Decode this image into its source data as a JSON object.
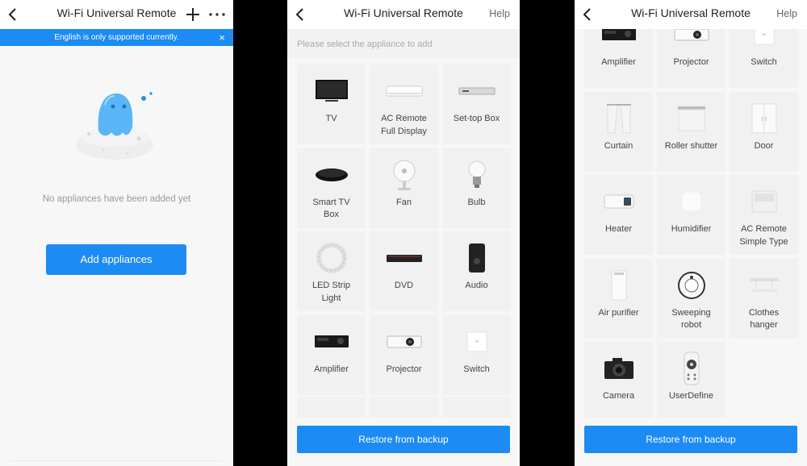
{
  "screen1": {
    "title": "Wi-Fi Universal Remote",
    "banner_text": "English is only supported currently.",
    "banner_close": "×",
    "empty_text": "No appliances have been added yet",
    "add_button": "Add appliances"
  },
  "screen2": {
    "title": "Wi-Fi Universal Remote",
    "help": "Help",
    "subhead": "Please select the appliance to add",
    "tiles": [
      {
        "label": "TV",
        "icon": "tv-icon"
      },
      {
        "label": "AC Remote\nFull Display",
        "icon": "ac-icon"
      },
      {
        "label": "Set-top Box",
        "icon": "settop-box-icon"
      },
      {
        "label": "Smart TV\nBox",
        "icon": "smart-tv-box-icon"
      },
      {
        "label": "Fan",
        "icon": "fan-icon"
      },
      {
        "label": "Bulb",
        "icon": "bulb-icon"
      },
      {
        "label": "LED Strip\nLight",
        "icon": "led-strip-icon"
      },
      {
        "label": "DVD",
        "icon": "dvd-icon"
      },
      {
        "label": "Audio",
        "icon": "audio-icon"
      },
      {
        "label": "Amplifier",
        "icon": "amplifier-icon"
      },
      {
        "label": "Projector",
        "icon": "projector-icon"
      },
      {
        "label": "Switch",
        "icon": "switch-icon"
      }
    ],
    "restore": "Restore from backup"
  },
  "screen3": {
    "title": "Wi-Fi Universal Remote",
    "help": "Help",
    "tiles": [
      {
        "label": "Amplifier",
        "icon": "amplifier-icon"
      },
      {
        "label": "Projector",
        "icon": "projector-icon"
      },
      {
        "label": "Switch",
        "icon": "switch-icon"
      },
      {
        "label": "Curtain",
        "icon": "curtain-icon"
      },
      {
        "label": "Roller shutter",
        "icon": "roller-shutter-icon"
      },
      {
        "label": "Door",
        "icon": "door-icon"
      },
      {
        "label": "Heater",
        "icon": "heater-icon"
      },
      {
        "label": "Humidifier",
        "icon": "humidifier-icon"
      },
      {
        "label": "AC Remote\nSimple Type",
        "icon": "ac-simple-icon"
      },
      {
        "label": "Air purifier",
        "icon": "air-purifier-icon"
      },
      {
        "label": "Sweeping\nrobot",
        "icon": "sweeping-robot-icon"
      },
      {
        "label": "Clothes\nhanger",
        "icon": "clothes-hanger-icon"
      },
      {
        "label": "Camera",
        "icon": "camera-icon"
      },
      {
        "label": "UserDefine",
        "icon": "user-define-icon"
      }
    ],
    "restore": "Restore from backup"
  },
  "colors": {
    "accent": "#1c8bf4",
    "tile_bg": "#f1f1f1",
    "screen_bg": "#f7f7f7"
  }
}
